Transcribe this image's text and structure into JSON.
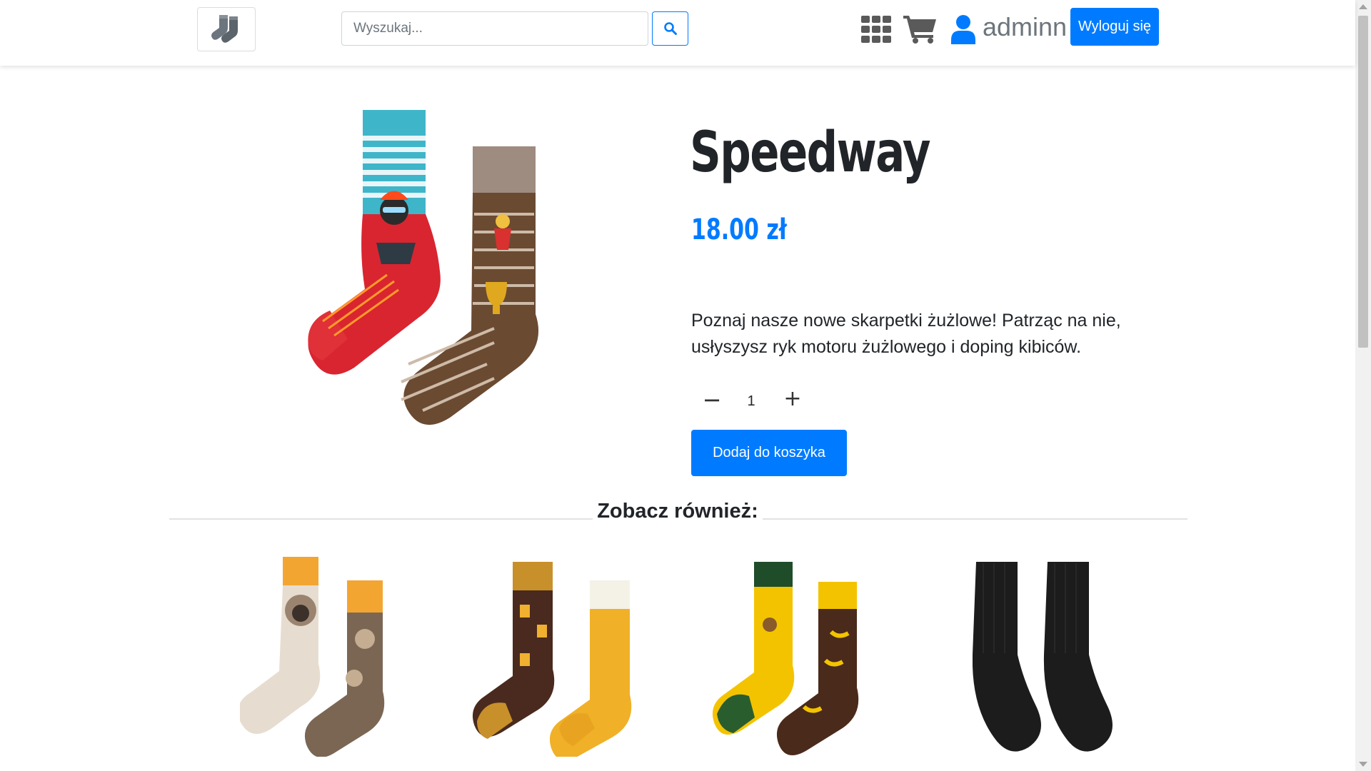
{
  "navbar": {
    "logo_icon": "socks-icon",
    "search": {
      "placeholder": "Wyszukaj...",
      "value": ""
    },
    "search_icon": "search-icon",
    "grid_icon": "grid-icon",
    "cart_icon": "cart-icon",
    "user_icon": "user-icon",
    "username": "adminn",
    "logout_label": "Wyloguj się"
  },
  "product": {
    "title": "Speedway",
    "price": "18.00 zł",
    "description": "Poznaj nasze nowe skarpetki żużlowe! Patrząc na nie, usłyszysz ryk motoru żużlowego i doping kibiców.",
    "quantity": "1",
    "minus_label": "−",
    "plus_label": "+",
    "add_to_cart_label": "Dodaj do koszyka"
  },
  "see_also": {
    "title": "Zobacz również:",
    "items": [
      {
        "image": "pug-socks"
      },
      {
        "image": "beer-socks"
      },
      {
        "image": "monkey-banana-socks"
      },
      {
        "image": "black-socks"
      }
    ]
  },
  "colors": {
    "primary": "#007bff",
    "text": "#212529",
    "muted": "#6c757d"
  }
}
